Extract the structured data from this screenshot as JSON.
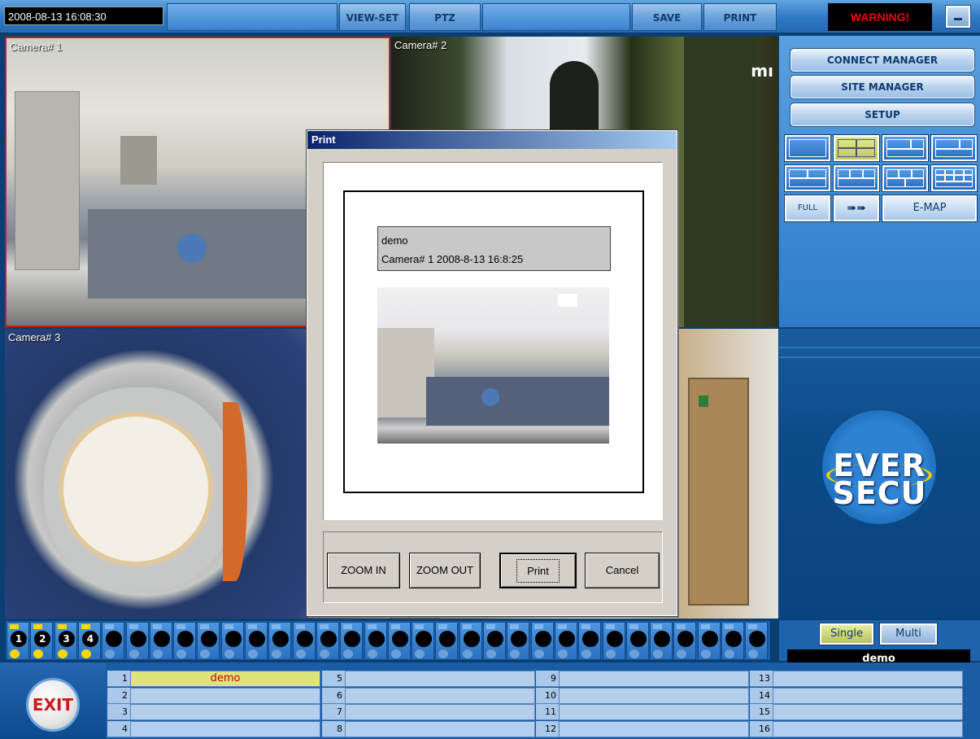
{
  "topbar": {
    "datetime": "2008-08-13   16:08:30",
    "view_set": "VIEW-SET",
    "ptz": "PTZ",
    "save": "SAVE",
    "print": "PRINT",
    "warning": "WARNING!"
  },
  "cameras": [
    {
      "label": "Camera# 1"
    },
    {
      "label": "Camera# 2"
    },
    {
      "label": "Camera# 3"
    },
    {
      "label": ""
    }
  ],
  "cam2_overlay": "mı",
  "right_panel": {
    "connect_manager": "CONNECT MANAGER",
    "site_manager": "SITE MANAGER",
    "setup": "SETUP",
    "full": "FULL",
    "next_icon": "double-arrow-icon",
    "emap": "E-MAP",
    "logo_line1": "EVER",
    "logo_line2": "SECU"
  },
  "print_dialog": {
    "title": "Print",
    "site": "demo",
    "caption": "Camera# 1 2008-8-13  16:8:25",
    "zoom_in": "ZOOM IN",
    "zoom_out": "ZOOM OUT",
    "print": "Print",
    "cancel": "Cancel"
  },
  "camera_strip": {
    "numbers": [
      "1",
      "2",
      "3",
      "4"
    ],
    "total_slots": 32
  },
  "view_mode": {
    "single": "Single",
    "multi": "Multi",
    "current_site": "demo"
  },
  "exit": "EXIT",
  "sites": [
    [
      {
        "num": "1",
        "name": "demo"
      },
      {
        "num": "2",
        "name": ""
      },
      {
        "num": "3",
        "name": ""
      },
      {
        "num": "4",
        "name": ""
      }
    ],
    [
      {
        "num": "5",
        "name": ""
      },
      {
        "num": "6",
        "name": ""
      },
      {
        "num": "7",
        "name": ""
      },
      {
        "num": "8",
        "name": ""
      }
    ],
    [
      {
        "num": "9",
        "name": ""
      },
      {
        "num": "10",
        "name": ""
      },
      {
        "num": "11",
        "name": ""
      },
      {
        "num": "12",
        "name": ""
      }
    ],
    [
      {
        "num": "13",
        "name": ""
      },
      {
        "num": "14",
        "name": ""
      },
      {
        "num": "15",
        "name": ""
      },
      {
        "num": "16",
        "name": ""
      }
    ]
  ]
}
